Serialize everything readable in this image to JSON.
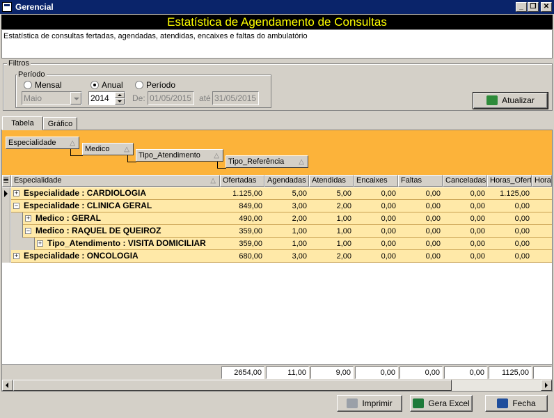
{
  "window": {
    "title": "Gerencial"
  },
  "banner": "Estatística de Agendamento de Consultas",
  "description": "Estatística de consultas fertadas, agendadas, atendidas, encaixes e faltas do ambulatório",
  "filters": {
    "group_label": "Filtros",
    "period_label": "Período",
    "radio_mensal": "Mensal",
    "radio_anual": "Anual",
    "radio_periodo": "Período",
    "selected_radio": "Anual",
    "month_value": "Maio",
    "year_value": "2014",
    "de_label": "De:",
    "date_from": "01/05/2015",
    "ate_label": "até",
    "date_to": "31/05/2015",
    "refresh_button": "Atualizar"
  },
  "tabs": [
    "Tabela",
    "Gráfico"
  ],
  "group_fields": [
    "Especialidade",
    "Medico",
    "Tipo_Atendimento",
    "Tipo_Referência"
  ],
  "columns": [
    "Especialidade",
    "Ofertadas",
    "Agendadas",
    "Atendidas",
    "Encaixes",
    "Faltas",
    "Canceladas",
    "Horas_Ofertadas",
    "Horas"
  ],
  "rows": [
    {
      "label": "Especialidade : CARDIOLOGIA",
      "expander": "+",
      "ofertadas": "1.125,00",
      "agendadas": "5,00",
      "atendidas": "5,00",
      "encaixes": "0,00",
      "faltas": "0,00",
      "canceladas": "0,00",
      "horas_ofertadas": "1.125,00"
    },
    {
      "label": "Especialidade : CLINICA GERAL",
      "expander": "−",
      "ofertadas": "849,00",
      "agendadas": "3,00",
      "atendidas": "2,00",
      "encaixes": "0,00",
      "faltas": "0,00",
      "canceladas": "0,00",
      "horas_ofertadas": "0,00"
    },
    {
      "label": "Medico : GERAL",
      "expander": "+",
      "ofertadas": "490,00",
      "agendadas": "2,00",
      "atendidas": "1,00",
      "encaixes": "0,00",
      "faltas": "0,00",
      "canceladas": "0,00",
      "horas_ofertadas": "0,00"
    },
    {
      "label": "Medico : RAQUEL DE QUEIROZ",
      "expander": "−",
      "ofertadas": "359,00",
      "agendadas": "1,00",
      "atendidas": "1,00",
      "encaixes": "0,00",
      "faltas": "0,00",
      "canceladas": "0,00",
      "horas_ofertadas": "0,00"
    },
    {
      "label": "Tipo_Atendimento : VISITA DOMICILIAR",
      "expander": "+",
      "ofertadas": "359,00",
      "agendadas": "1,00",
      "atendidas": "1,00",
      "encaixes": "0,00",
      "faltas": "0,00",
      "canceladas": "0,00",
      "horas_ofertadas": "0,00"
    },
    {
      "label": "Especialidade : ONCOLOGIA",
      "expander": "+",
      "ofertadas": "680,00",
      "agendadas": "3,00",
      "atendidas": "2,00",
      "encaixes": "0,00",
      "faltas": "0,00",
      "canceladas": "0,00",
      "horas_ofertadas": "0,00"
    }
  ],
  "totals": [
    "2654,00",
    "11,00",
    "9,00",
    "0,00",
    "0,00",
    "0,00",
    "1125,00"
  ],
  "buttons": {
    "print": "Imprimir",
    "excel": "Gera Excel",
    "close": "Fecha"
  },
  "colors": {
    "banner_bg": "#000000",
    "banner_text": "#ffff00",
    "group_area": "#fcb33a",
    "row_band": "#ffe9a8",
    "titlebar": "#0a246a"
  }
}
